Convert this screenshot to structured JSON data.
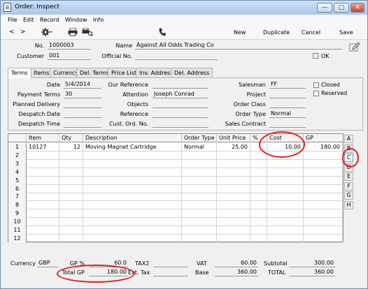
{
  "window": {
    "title": "Order: Inspect",
    "min": "—",
    "max": "▢",
    "close": "✕"
  },
  "menu": [
    "File",
    "Edit",
    "Record",
    "Window",
    "Info"
  ],
  "toolbar": {
    "prev": "<",
    "next": ">",
    "actions_icon": "gear-icon",
    "print_icon": "printer-icon",
    "preview_icon": "print-preview-icon",
    "phone_icon": "phone-icon",
    "new": "New",
    "duplicate": "Duplicate",
    "cancel": "Cancel",
    "save": "Save"
  },
  "header": {
    "no_label": "No.",
    "no": "1000003",
    "customer_label": "Customer",
    "customer": "001",
    "name_label": "Name",
    "name": "Against All Odds Trading Co",
    "official_label": "Official No.",
    "official": "",
    "ok_label": "OK"
  },
  "tabs": [
    "Terms",
    "Items",
    "Currency",
    "Del. Terms",
    "Price List",
    "Inv. Address",
    "Del. Address"
  ],
  "terms": {
    "date_label": "Date",
    "date": "5/4/2014",
    "payterms_label": "Payment Terms",
    "payterms": "30",
    "planned_label": "Planned Delivery",
    "planned": "",
    "despdate_label": "Despatch Date",
    "despdate": "",
    "desptime_label": "Despatch Time",
    "desptime": "",
    "ourref_label": "Our Reference",
    "ourref": "",
    "attention_label": "Attention",
    "attention": "Joseph Conrad",
    "objects_label": "Objects",
    "objects": "",
    "reference_label": "Reference",
    "reference": "",
    "custord_label": "Cust. Ord. No.",
    "custord": "",
    "salesman_label": "Salesman",
    "salesman": "FF",
    "project_label": "Project",
    "project": "",
    "orderclass_label": "Order Class",
    "orderclass": "",
    "ordertype_label": "Order Type",
    "ordertype": "Normal",
    "salescontract_label": "Sales Contract",
    "salescontract": "",
    "closed_label": "Closed",
    "reserved_label": "Reserved"
  },
  "grid": {
    "columns": [
      "Item",
      "Qty",
      "Description",
      "Order Type",
      "Unit Price",
      "%",
      "Cost",
      "GP"
    ],
    "rows": [
      {
        "n": "1",
        "item": "10127",
        "qty": "12",
        "desc": "Moving Magnet Cartridge",
        "otype": "Normal",
        "price": "25.00",
        "pct": "",
        "cost": "10.00",
        "gp": "180.00"
      },
      {
        "n": "2"
      },
      {
        "n": "3"
      },
      {
        "n": "4"
      },
      {
        "n": "5"
      },
      {
        "n": "6"
      },
      {
        "n": "7"
      },
      {
        "n": "8"
      },
      {
        "n": "9"
      },
      {
        "n": "10"
      },
      {
        "n": "11"
      },
      {
        "n": "12"
      }
    ],
    "side_tabs": [
      "A",
      "B",
      "C",
      "D",
      "E",
      "F",
      "G",
      "H"
    ],
    "active_side_tab": "C"
  },
  "footer": {
    "currency_label": "Currency",
    "currency": "GBP",
    "gppct_label": "GP %",
    "gppct": "60.0",
    "totalgp_label": "Total GP",
    "totalgp": "180.00",
    "tax2_label": "TAX2",
    "tax2": "",
    "exttax_label": "Ext. Tax",
    "exttax": "",
    "vat_label": "VAT",
    "vat": "60.00",
    "base_label": "Base",
    "base": "360.00",
    "subtotal_label": "Subtotal",
    "subtotal": "300.00",
    "total_label": "TOTAL",
    "total": "360.00"
  },
  "colors": {
    "annotation": "#e51b1b",
    "titlebar": "#a9c7ea"
  }
}
